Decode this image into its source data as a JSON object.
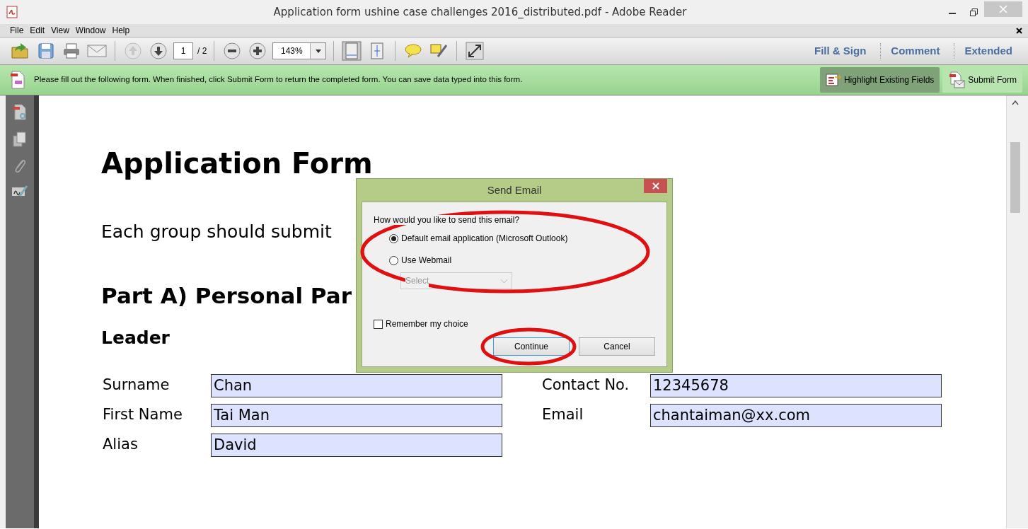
{
  "window": {
    "title": "Application form ushine case challenges 2016_distributed.pdf - Adobe Reader"
  },
  "menu": [
    "File",
    "Edit",
    "View",
    "Window",
    "Help"
  ],
  "toolbar": {
    "page_number": "1",
    "page_total": "/ 2",
    "zoom": "143%",
    "panels": [
      "Fill & Sign",
      "Comment",
      "Extended"
    ]
  },
  "form_bar": {
    "message": "Please fill out the following form. When finished, click Submit Form to return the completed form. You can save data typed into this form.",
    "buttons": [
      {
        "label": "Highlight Existing Fields",
        "pressed": true,
        "kind": "highlight"
      },
      {
        "label": "Submit Form",
        "pressed": false,
        "kind": "submit"
      }
    ]
  },
  "document": {
    "title": "Application Form",
    "intro": "Each group should submit",
    "section": "Part A) Personal Par",
    "subsection": "Leader",
    "left_fields": [
      {
        "label": "Surname",
        "value": "Chan"
      },
      {
        "label": "First Name",
        "value": "Tai Man"
      },
      {
        "label": "Alias",
        "value": "David"
      }
    ],
    "right_fields": [
      {
        "label": "Contact No.",
        "value": "12345678"
      },
      {
        "label": "Email",
        "value": "chantaiman@xx.com"
      }
    ]
  },
  "dialog": {
    "title": "Send Email",
    "question": "How would you like to send this email?",
    "options": [
      {
        "label": "Default email application (Microsoft Outlook)",
        "selected": true
      },
      {
        "label": "Use Webmail",
        "selected": false
      }
    ],
    "webmail_select": {
      "placeholder": "Select",
      "disabled": true
    },
    "remember": {
      "label": "Remember my choice",
      "checked": false
    },
    "buttons": [
      {
        "label": "Continue",
        "default": true
      },
      {
        "label": "Cancel",
        "default": false
      }
    ]
  }
}
